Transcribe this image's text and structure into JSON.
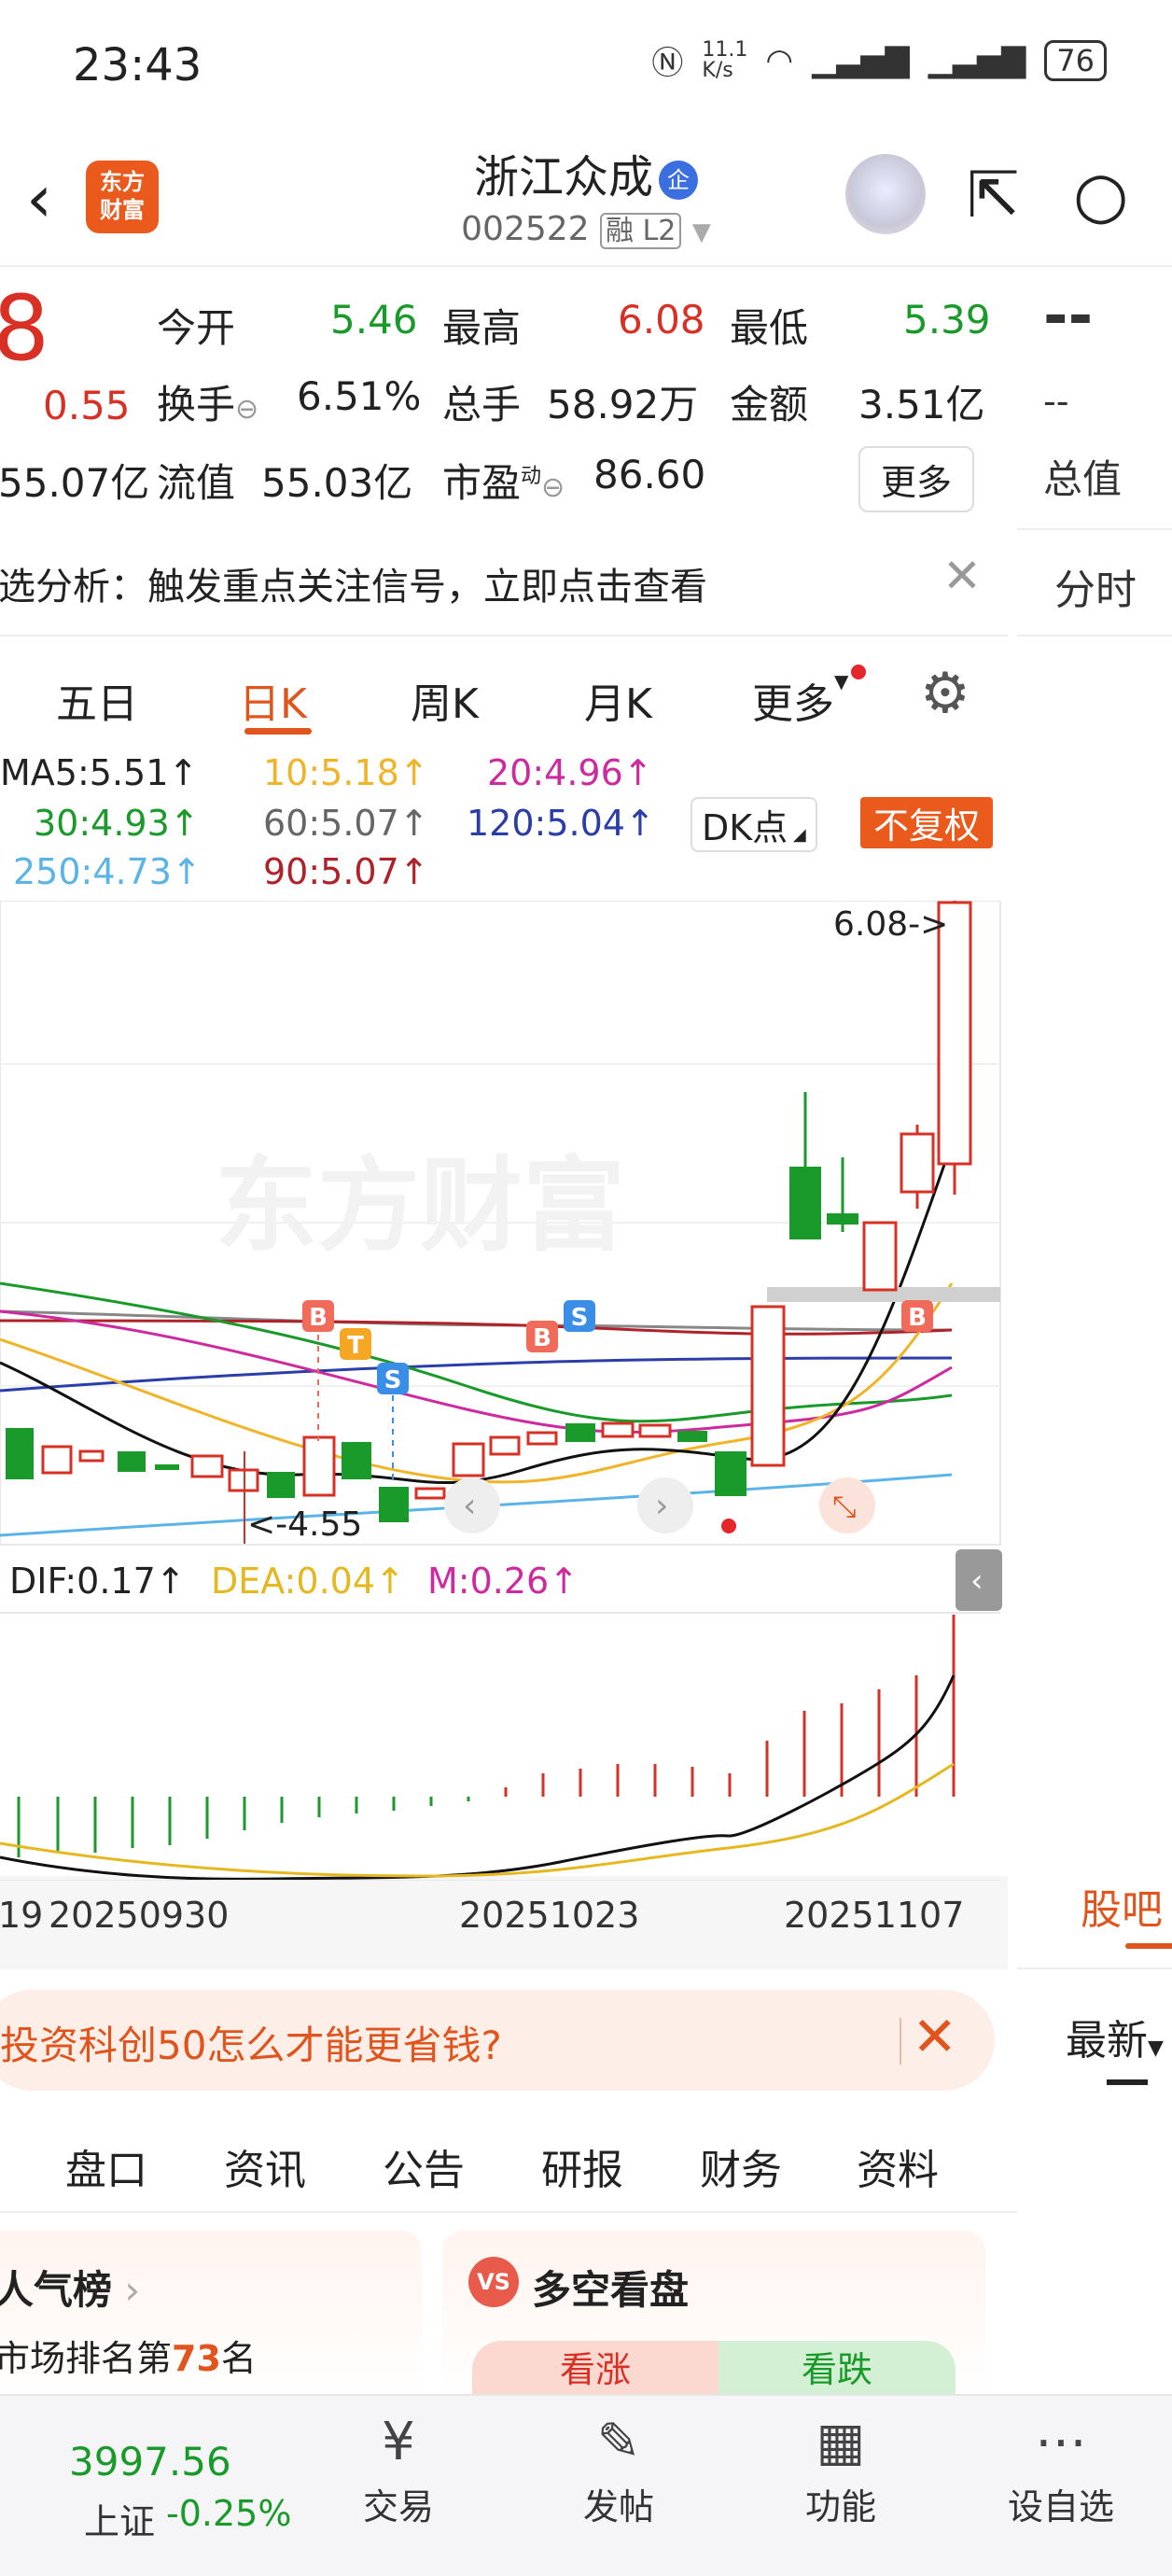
{
  "status_bar": {
    "time": "23:43",
    "net_speed": "11.1 K/s",
    "battery": "76"
  },
  "header": {
    "title": "浙江众成",
    "corp_badge": "企",
    "code": "002522",
    "tags": "融 L2",
    "logo_text": "东方财富"
  },
  "quote": {
    "price_partial": "8",
    "change": "0.55",
    "total_partial": "55.07亿",
    "open_label": "今开",
    "open": "5.46",
    "high_label": "最高",
    "high": "6.08",
    "low_label": "最低",
    "low": "5.39",
    "turnover_label": "换手",
    "turnover": "6.51%",
    "volume_label": "总手",
    "volume": "58.92万",
    "amount_label": "金额",
    "amount": "3.51亿",
    "float_label": "流值",
    "float_value": "55.03亿",
    "pe_label": "市盈",
    "pe_sup": "动",
    "pe": "86.60",
    "more_label": "更多"
  },
  "right_panel": {
    "dashes": "--",
    "sub_dash": "--",
    "total_label": "总值",
    "tab_label": "分时",
    "guba_label": "股吧",
    "latest_label": "最新"
  },
  "notice": {
    "text": "选分析：触发重点关注信号，立即点击查看"
  },
  "period_tabs": [
    {
      "label": "五日"
    },
    {
      "label": "日K"
    },
    {
      "label": "周K"
    },
    {
      "label": "月K"
    },
    {
      "label": "更多"
    }
  ],
  "ma": {
    "ma5": "MA5:5.51↑",
    "ma10": "10:5.18↑",
    "ma20": "20:4.96↑",
    "ma30": "30:4.93↑",
    "ma60": "60:5.07↑",
    "ma120": "120:5.04↑",
    "ma250": "250:4.73↑",
    "ma90": "90:5.07↑",
    "dk": "DK点",
    "fuquan": "不复权",
    "colors": {
      "ma5": "#222222",
      "ma10": "#f0b429",
      "ma20": "#cc2a9e",
      "ma30": "#1a9a2a",
      "ma60": "#666666",
      "ma120": "#2a3da8",
      "ma250": "#5bb4e8",
      "ma90": "#b0222a"
    }
  },
  "chart_data": {
    "type": "candlestick",
    "high_label": "6.08->",
    "low_label": "<-4.55",
    "watermark": "东方财富",
    "macd": {
      "dif": "DIF:0.17↑",
      "dea": "DEA:0.04↑",
      "m": "M:0.26↑"
    },
    "x_ticks": [
      "19",
      "20250930",
      "20251023",
      "20251107"
    ],
    "signals": [
      "B",
      "T",
      "S",
      "B",
      "S",
      "B"
    ]
  },
  "promo": {
    "text": "投资科创50怎么才能更省钱?",
    "close": "✕"
  },
  "sub_tabs": [
    {
      "label": "盘口"
    },
    {
      "label": "资讯"
    },
    {
      "label": "公告"
    },
    {
      "label": "研报"
    },
    {
      "label": "财务"
    },
    {
      "label": "资料"
    }
  ],
  "cards": {
    "hot_title": "人气榜",
    "hot_rank_prefix": "市场排名第",
    "hot_rank": "73",
    "hot_rank_suffix": "名",
    "duokong_icon": "VS",
    "duokong_title": "多空看盘",
    "up": "看涨",
    "down": "看跌"
  },
  "bottom_nav": {
    "index_value": "3997.56",
    "index_name": "上证",
    "index_change": "-0.25%",
    "items": [
      {
        "label": "交易"
      },
      {
        "label": "发帖"
      },
      {
        "label": "功能"
      },
      {
        "label": "设自选"
      }
    ]
  }
}
